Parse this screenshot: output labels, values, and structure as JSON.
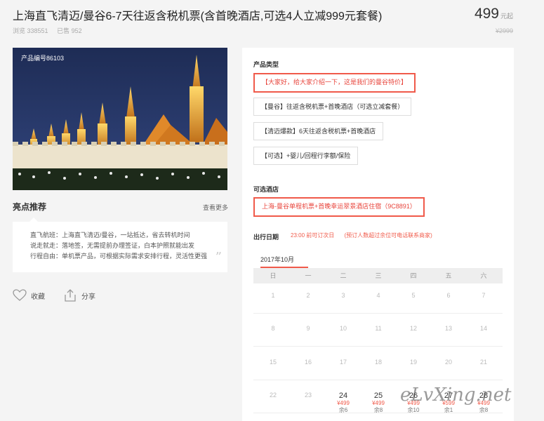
{
  "header": {
    "title": "上海直飞清迈/曼谷6-7天往返含税机票(含首晚酒店,可选4人立减999元套餐)",
    "views": "浏览 338551",
    "sold": "已售 952",
    "price": "499",
    "price_unit": "元起",
    "original_price": "¥2999"
  },
  "hero": {
    "product_no": "产品编号86103"
  },
  "highlights": {
    "title": "亮点推荐",
    "more": "查看更多",
    "lines": [
      "直飞航班：上海直飞清迈/曼谷，一站抵达，省去转机时间",
      "说走就走：落地签，无需提前办理签证，白本护照就能出发",
      "行程自由：单机票产品，可根据实际需求安排行程，灵活性更强"
    ]
  },
  "actions": {
    "favorite": "收藏",
    "share": "分享"
  },
  "product_type": {
    "label": "产品类型",
    "options": [
      "【大家好，给大家介绍一下，这是我们的曼谷特价】",
      "【曼谷】往返含税机票+首晚酒店（可选立减套餐）",
      "【清迈爆款】6天往返含税机票+首晚酒店",
      "【可选】+婴儿/回程行李额/保险"
    ],
    "selected_index": 0
  },
  "hotel": {
    "label": "可选酒店",
    "option": "上海-曼谷单程机票+首晚幸运翠景酒店住宿（9C8891）"
  },
  "travel_date": {
    "label": "出行日期",
    "note1": "23:00 前可订次日",
    "note2": "(预订人数超过余位可电话联系商家)",
    "month": "2017年10月",
    "weekdays": [
      "日",
      "一",
      "二",
      "三",
      "四",
      "五",
      "六"
    ],
    "weeks": [
      [
        {
          "d": "1"
        },
        {
          "d": "2"
        },
        {
          "d": "3"
        },
        {
          "d": "4"
        },
        {
          "d": "5"
        },
        {
          "d": "6"
        },
        {
          "d": "7"
        }
      ],
      [
        {
          "d": "8"
        },
        {
          "d": "9"
        },
        {
          "d": "10"
        },
        {
          "d": "11"
        },
        {
          "d": "12"
        },
        {
          "d": "13"
        },
        {
          "d": "14"
        }
      ],
      [
        {
          "d": "15"
        },
        {
          "d": "16"
        },
        {
          "d": "17"
        },
        {
          "d": "18"
        },
        {
          "d": "19"
        },
        {
          "d": "20"
        },
        {
          "d": "21"
        }
      ],
      [
        {
          "d": "22"
        },
        {
          "d": "23"
        },
        {
          "d": "24",
          "price": "¥499",
          "left": "余6"
        },
        {
          "d": "25",
          "price": "¥499",
          "left": "余8"
        },
        {
          "d": "26",
          "price": "¥499",
          "left": "余10"
        },
        {
          "d": "27",
          "price": "¥599",
          "left": "余1"
        },
        {
          "d": "28",
          "price": "¥499",
          "left": "余8"
        }
      ]
    ]
  },
  "watermark": "eLvXing.net",
  "colors": {
    "accent": "#f05a4a",
    "background": "#f4f4f4",
    "panel": "#ffffff"
  }
}
